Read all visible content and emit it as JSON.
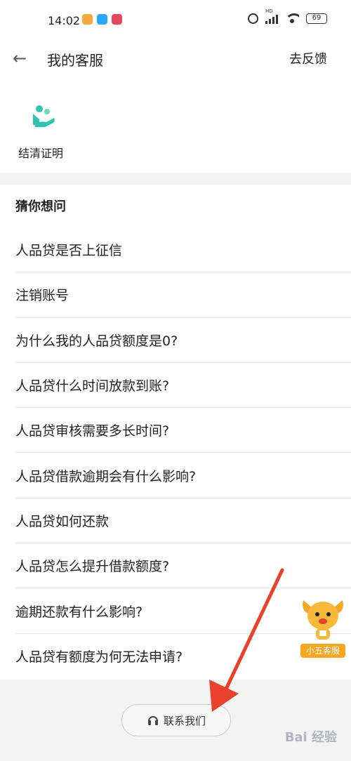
{
  "status_bar": {
    "time": "14:02",
    "battery": "69",
    "app_icons": [
      {
        "name": "wallet-app-icon",
        "color": "#f4a93b"
      },
      {
        "name": "chat-app-icon",
        "color": "#2aa7ff"
      },
      {
        "name": "music-app-icon",
        "color": "#e8455f"
      }
    ]
  },
  "nav": {
    "title": "我的客服",
    "feedback": "去反馈"
  },
  "shortcut": {
    "label": "结清证明",
    "icon_color": "#2ec4b0"
  },
  "faq": {
    "header": "猜你想问",
    "items": [
      "人品贷是否上征信",
      "注销账号",
      "为什么我的人品贷额度是0?",
      "人品贷什么时间放款到账?",
      "人品贷审核需要多长时间?",
      "人品贷借款逾期会有什么影响?",
      "人品贷如何还款",
      "人品贷怎么提升借款额度?",
      "逾期还款有什么影响?",
      "人品贷有额度为何无法申请?"
    ]
  },
  "mascot": {
    "label": "小五客服"
  },
  "contact": {
    "label": "联系我们"
  },
  "watermark": "Bai 经验",
  "colors": {
    "accent_teal": "#2ec4b0",
    "annotation_red": "#e8412c",
    "mascot_orange": "#f5a623"
  }
}
